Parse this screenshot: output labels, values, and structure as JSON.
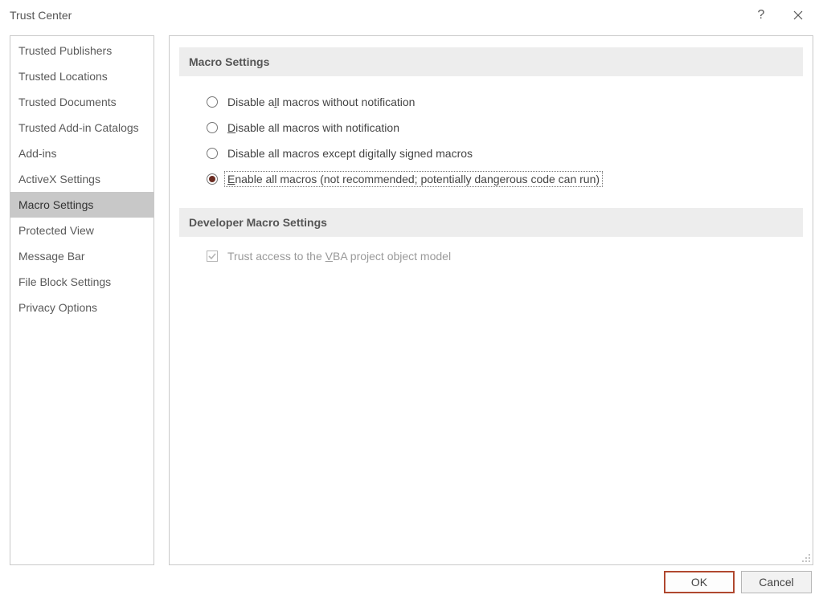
{
  "window": {
    "title": "Trust Center",
    "help_symbol": "?"
  },
  "sidebar": {
    "items": [
      {
        "label": "Trusted Publishers"
      },
      {
        "label": "Trusted Locations"
      },
      {
        "label": "Trusted Documents"
      },
      {
        "label": "Trusted Add-in Catalogs"
      },
      {
        "label": "Add-ins"
      },
      {
        "label": "ActiveX Settings"
      },
      {
        "label": "Macro Settings"
      },
      {
        "label": "Protected View"
      },
      {
        "label": "Message Bar"
      },
      {
        "label": "File Block Settings"
      },
      {
        "label": "Privacy Options"
      }
    ],
    "selected_index": 6
  },
  "sections": {
    "macro": {
      "heading": "Macro Settings",
      "options": [
        {
          "pre": "Disable a",
          "mnemonic": "l",
          "post": "l macros without notification"
        },
        {
          "pre": "",
          "mnemonic": "D",
          "post": "isable all macros with notification"
        },
        {
          "pre": "Disable all macros except di",
          "mnemonic": "g",
          "post": "itally signed macros"
        },
        {
          "pre": "",
          "mnemonic": "E",
          "post": "nable all macros (not recommended; potentially dangerous code can run)"
        }
      ],
      "selected_index": 3
    },
    "developer": {
      "heading": "Developer Macro Settings",
      "trust_vba": {
        "pre": "Trust access to the ",
        "mnemonic": "V",
        "post": "BA project object model",
        "checked": true,
        "disabled": true
      }
    }
  },
  "buttons": {
    "ok": "OK",
    "cancel": "Cancel"
  }
}
